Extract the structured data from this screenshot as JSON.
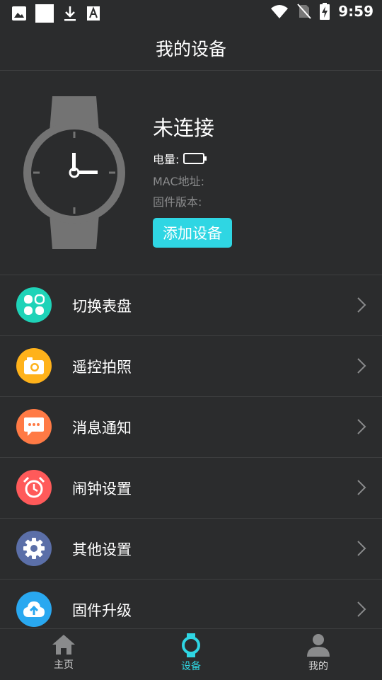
{
  "status_bar": {
    "time": "9:59",
    "left_icons": [
      "gallery-icon",
      "white-square-icon",
      "download-icon",
      "font-a-icon"
    ],
    "right_icons": [
      "wifi-icon",
      "no-sim-icon",
      "battery-charging-icon"
    ]
  },
  "header": {
    "title": "我的设备"
  },
  "device": {
    "status": "未连接",
    "battery_label": "电量:",
    "mac_label": "MAC地址:",
    "firmware_label": "固件版本:",
    "add_button": "添加设备"
  },
  "menu": {
    "items": [
      {
        "label": "切换表盘",
        "icon": "watchface-icon",
        "color": "#1fd3b8"
      },
      {
        "label": "遥控拍照",
        "icon": "camera-icon",
        "color": "#ffb21a"
      },
      {
        "label": "消息通知",
        "icon": "message-icon",
        "color": "#ff7a45"
      },
      {
        "label": "闹钟设置",
        "icon": "alarm-icon",
        "color": "#ff5a5a"
      },
      {
        "label": "其他设置",
        "icon": "gear-icon",
        "color": "#5b6fa8"
      },
      {
        "label": "固件升级",
        "icon": "cloud-upload-icon",
        "color": "#29a8f0"
      }
    ]
  },
  "bottom_nav": {
    "items": [
      {
        "label": "主页",
        "icon": "home-icon"
      },
      {
        "label": "设备",
        "icon": "watch-icon",
        "active": true
      },
      {
        "label": "我的",
        "icon": "person-icon"
      }
    ]
  },
  "colors": {
    "accent": "#2fd6e3",
    "background": "#2b2c2d"
  }
}
